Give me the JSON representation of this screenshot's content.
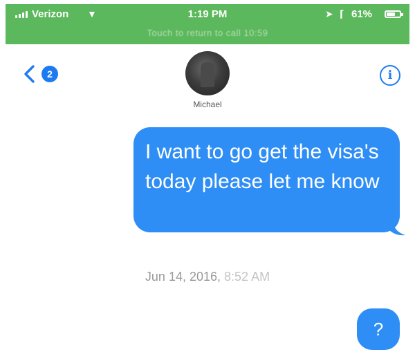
{
  "status_bar": {
    "carrier": "Verizon",
    "time": "1:19 PM",
    "battery": "61%",
    "battery_level": 0.61,
    "call_banner": "Touch to return to call 10:59",
    "color": "#5cb85c",
    "icons": [
      "signal-icon",
      "wifi-icon",
      "location-icon",
      "bluetooth-icon",
      "battery-icon"
    ]
  },
  "header": {
    "back_badge": "2",
    "contact_name": "Michael",
    "info_label": "i",
    "icons": [
      "back-chevron-icon",
      "info-icon"
    ]
  },
  "messages": [
    {
      "direction": "sent",
      "text": "I want to go get the visa's today please let me know"
    },
    {
      "direction": "sent",
      "text": "?"
    }
  ],
  "timestamp": {
    "date": "Jun 14, 2016,",
    "time": "8:52 AM"
  },
  "colors": {
    "accent": "#1d7bf2",
    "bubble": "#2e8ef5",
    "timestamp": "#9a9a9a"
  }
}
